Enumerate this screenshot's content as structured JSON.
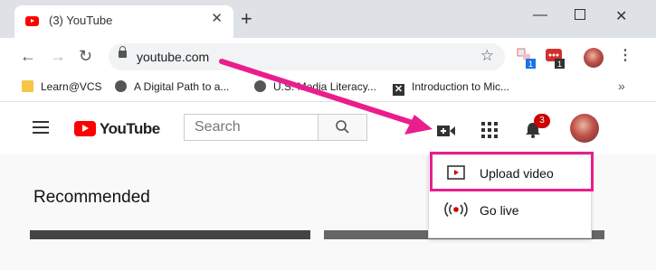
{
  "browser": {
    "tab_title": "(3) YouTube",
    "new_tab": "+",
    "url": "youtube.com",
    "window_controls": [
      "minimize-icon",
      "maximize-icon",
      "close-icon"
    ],
    "extensions": [
      {
        "icon": "extension-icon",
        "badge": "1"
      },
      {
        "icon": "extension-red-icon",
        "badge": "1"
      }
    ]
  },
  "bookmarks": [
    {
      "label": "Learn@VCS",
      "icon": "folder-icon"
    },
    {
      "label": "A Digital Path to a...",
      "icon": "globe-icon"
    },
    {
      "label": "U.S. Media Literacy...",
      "icon": "globe-icon"
    },
    {
      "label": "Introduction to Mic...",
      "icon": "x-icon"
    }
  ],
  "youtube": {
    "logo_text": "YouTube",
    "search_placeholder": "Search",
    "notifications_count": "3",
    "section_title": "Recommended"
  },
  "create_menu": {
    "items": [
      {
        "label": "Upload video",
        "icon": "upload-video-icon",
        "highlighted": true
      },
      {
        "label": "Go live",
        "icon": "go-live-icon"
      }
    ]
  },
  "annotation": {
    "color": "#e91e8c"
  }
}
